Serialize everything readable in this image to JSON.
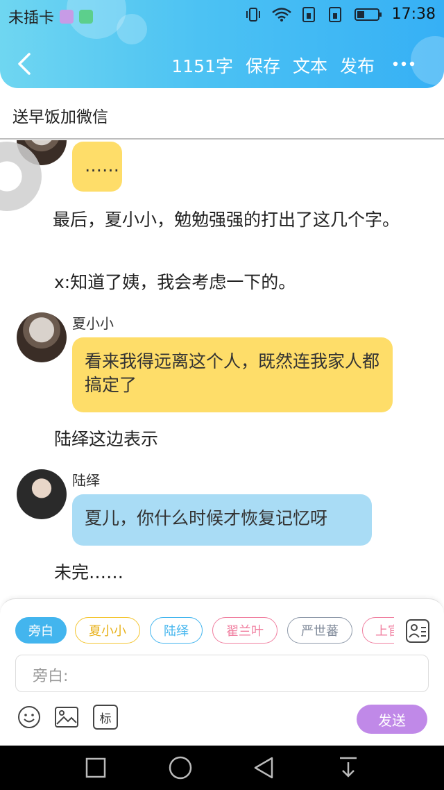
{
  "status_bar": {
    "carrier": "未插卡",
    "time": "17:38",
    "icons": [
      "gallery-app-icon",
      "store-app-icon",
      "vibrate-icon",
      "wifi-icon",
      "sim1-icon",
      "sim2-icon",
      "battery-icon"
    ]
  },
  "toolbar": {
    "word_count": "1151字",
    "save": "保存",
    "text": "文本",
    "publish": "发布"
  },
  "title": "送早饭加微信",
  "chat": {
    "msg1_text": "……",
    "narration1": "最后，夏小小，勉勉强强的打出了这几个字。",
    "narration2": "x:知道了姨，我会考虑一下的。",
    "msg2_name": "夏小小",
    "msg2_text": "看来我得远离这个人，既然连我家人都搞定了",
    "narration3": "陆绎这边表示",
    "msg3_name": "陆绎",
    "msg3_text": "夏儿，你什么时候才恢复记忆呀",
    "narration4": "未完……"
  },
  "roles": [
    {
      "label": "旁白",
      "color": "#43b5ee",
      "selected": true
    },
    {
      "label": "夏小小",
      "color": "#f4c531",
      "selected": false
    },
    {
      "label": "陆绎",
      "color": "#43b5ee",
      "selected": false
    },
    {
      "label": "翟兰叶",
      "color": "#f07fa0",
      "selected": false
    },
    {
      "label": "严世蕃",
      "color": "#8f9aaa",
      "selected": false
    },
    {
      "label": "上官",
      "color": "#f07fa0",
      "selected": false
    }
  ],
  "input": {
    "placeholder": "旁白:"
  },
  "send": "发送",
  "tool_labels": {
    "tag": "标"
  },
  "colors": {
    "header_gradient_start": "#6fd6f1",
    "header_gradient_end": "#36b0f5",
    "bubble_yellow": "#fedd69",
    "bubble_blue": "#a9dcf5",
    "send_button": "#c089e8"
  }
}
